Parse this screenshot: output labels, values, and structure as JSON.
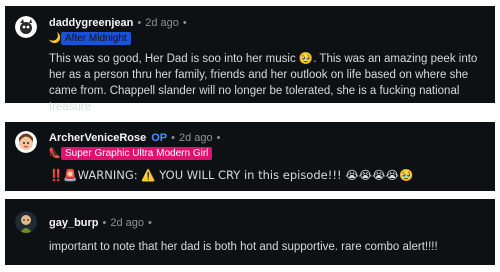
{
  "comments": [
    {
      "username": "daddygreenjean",
      "op_badge": "",
      "separator": "•",
      "time": "2d ago",
      "menu": "•",
      "flair_icon": "🌙",
      "flair": "After Midnight",
      "flair_color": "#1a52d8",
      "text": "This was so good, Her Dad is soo into her music 🥹. This was an amazing peek into her as a person thru her family, friends and her outlook on life based on where she came from. Chappell slander will no longer be tolerated, she is a fucking national treasure"
    },
    {
      "username": "ArcherVeniceRose",
      "op_badge": "OP",
      "separator": "•",
      "time": "2d ago",
      "menu": "•",
      "flair_icon": "👠",
      "flair": "Super Graphic Ultra Modern Girl",
      "flair_color": "#e0116f",
      "text": "‼️🚨WARNING: ⚠️ YOU WILL CRY in this episode!!! 😭😭😭😭🥹"
    },
    {
      "username": "gay_burp",
      "op_badge": "",
      "separator": "•",
      "time": "2d ago",
      "menu": "•",
      "flair_icon": "",
      "flair": "",
      "flair_color": "",
      "text": "important to note that her dad is both hot and supportive. rare combo alert!!!!"
    }
  ]
}
